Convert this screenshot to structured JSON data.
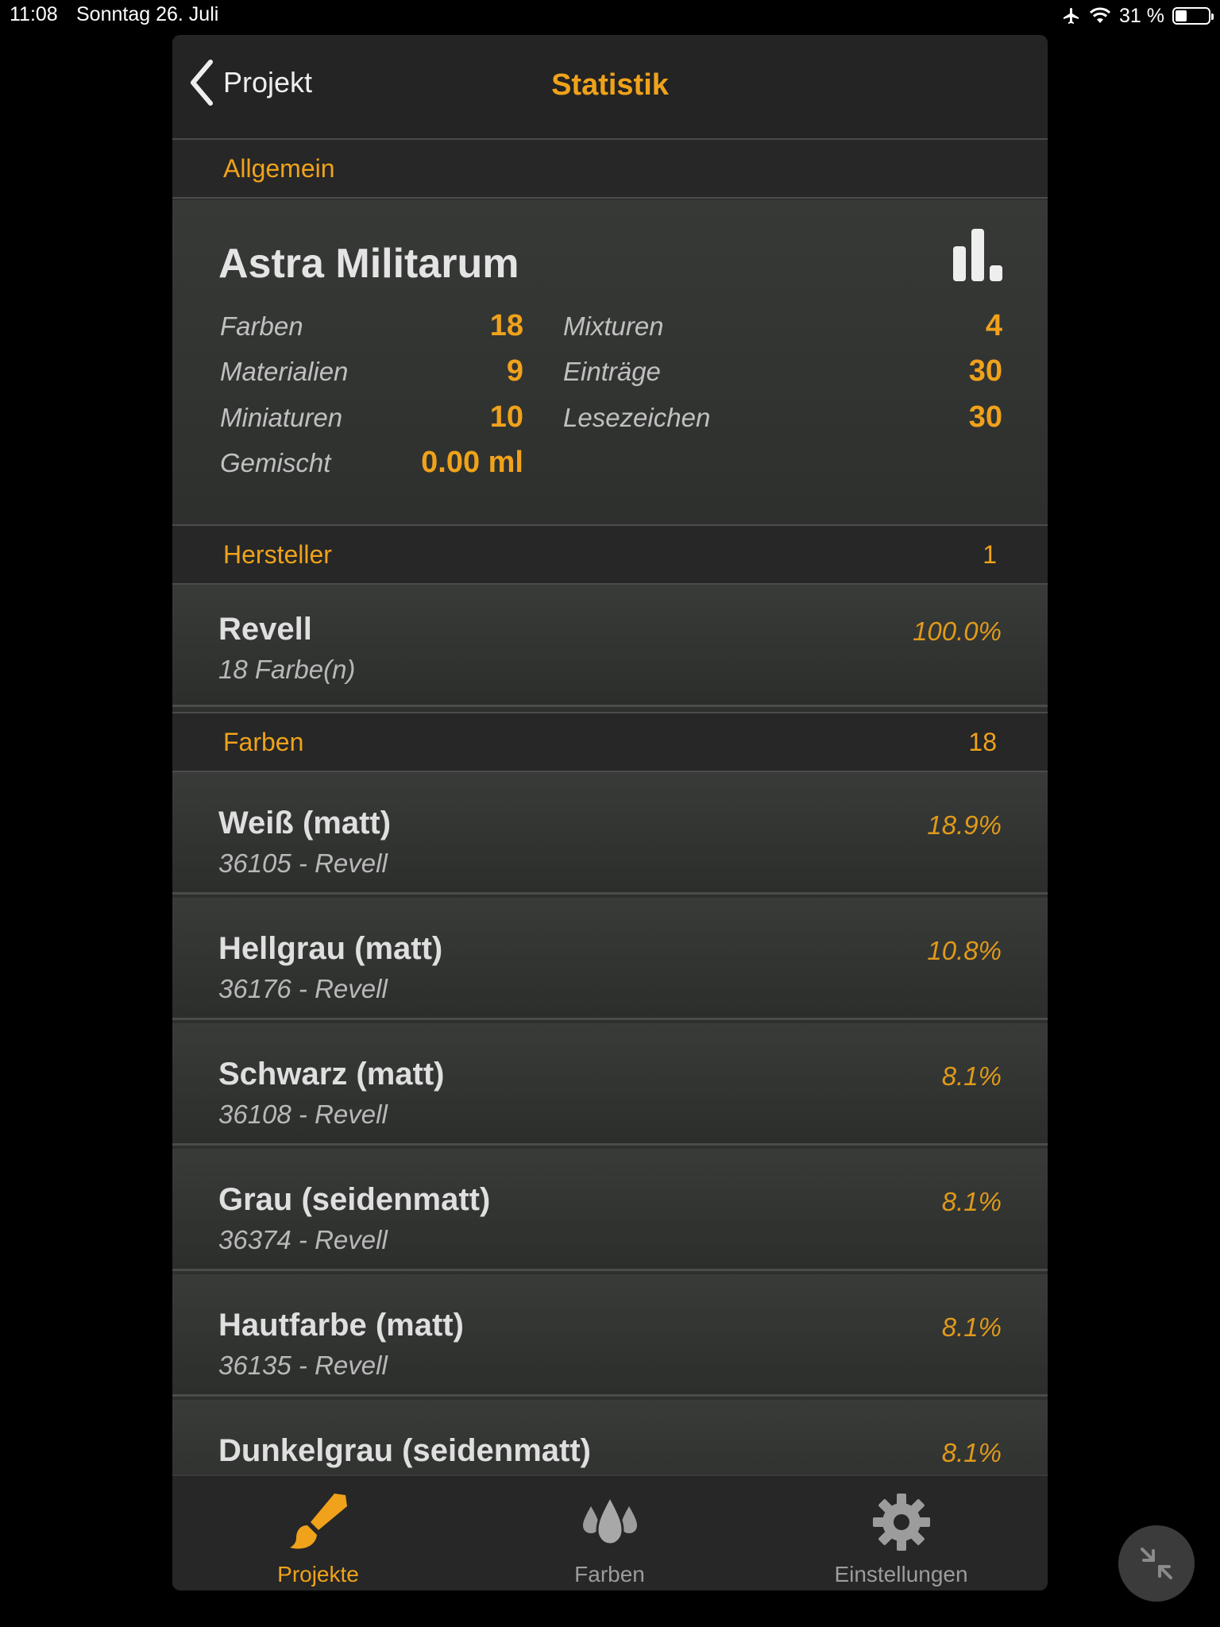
{
  "status_bar": {
    "time": "11:08",
    "date": "Sonntag 26. Juli",
    "battery": "31 %",
    "battery_level": 0.31
  },
  "nav": {
    "back_label": "Projekt",
    "title": "Statistik"
  },
  "general": {
    "header": "Allgemein",
    "project_name": "Astra Militarum",
    "left_stats": [
      {
        "label": "Farben",
        "value": "18"
      },
      {
        "label": "Materialien",
        "value": "9"
      },
      {
        "label": "Miniaturen",
        "value": "10"
      },
      {
        "label": "Gemischt",
        "value": "0.00 ml"
      }
    ],
    "right_stats": [
      {
        "label": "Mixturen",
        "value": "4"
      },
      {
        "label": "Einträge",
        "value": "30"
      },
      {
        "label": "Lesezeichen",
        "value": "30"
      }
    ]
  },
  "manufacturers": {
    "header": "Hersteller",
    "count": "1",
    "items": [
      {
        "name": "Revell",
        "sub": "18 Farbe(n)",
        "percent": "100.0%"
      }
    ]
  },
  "colors": {
    "header": "Farben",
    "count": "18",
    "items": [
      {
        "name": "Weiß (matt)",
        "sub": "36105 - Revell",
        "percent": "18.9%"
      },
      {
        "name": "Hellgrau (matt)",
        "sub": "36176 - Revell",
        "percent": "10.8%"
      },
      {
        "name": "Schwarz (matt)",
        "sub": "36108 - Revell",
        "percent": "8.1%"
      },
      {
        "name": "Grau (seidenmatt)",
        "sub": "36374 - Revell",
        "percent": "8.1%"
      },
      {
        "name": "Hautfarbe (matt)",
        "sub": "36135 - Revell",
        "percent": "8.1%"
      },
      {
        "name": "Dunkelgrau (seidenmatt)",
        "sub": "",
        "percent": "8.1%"
      }
    ]
  },
  "tabs": [
    {
      "label": "Projekte",
      "icon": "brush-icon",
      "active": true
    },
    {
      "label": "Farben",
      "icon": "drops-icon",
      "active": false
    },
    {
      "label": "Einstellungen",
      "icon": "gear-icon",
      "active": false
    }
  ],
  "colors_theme": {
    "accent": "#f0a21b",
    "background": "#2e302e"
  }
}
